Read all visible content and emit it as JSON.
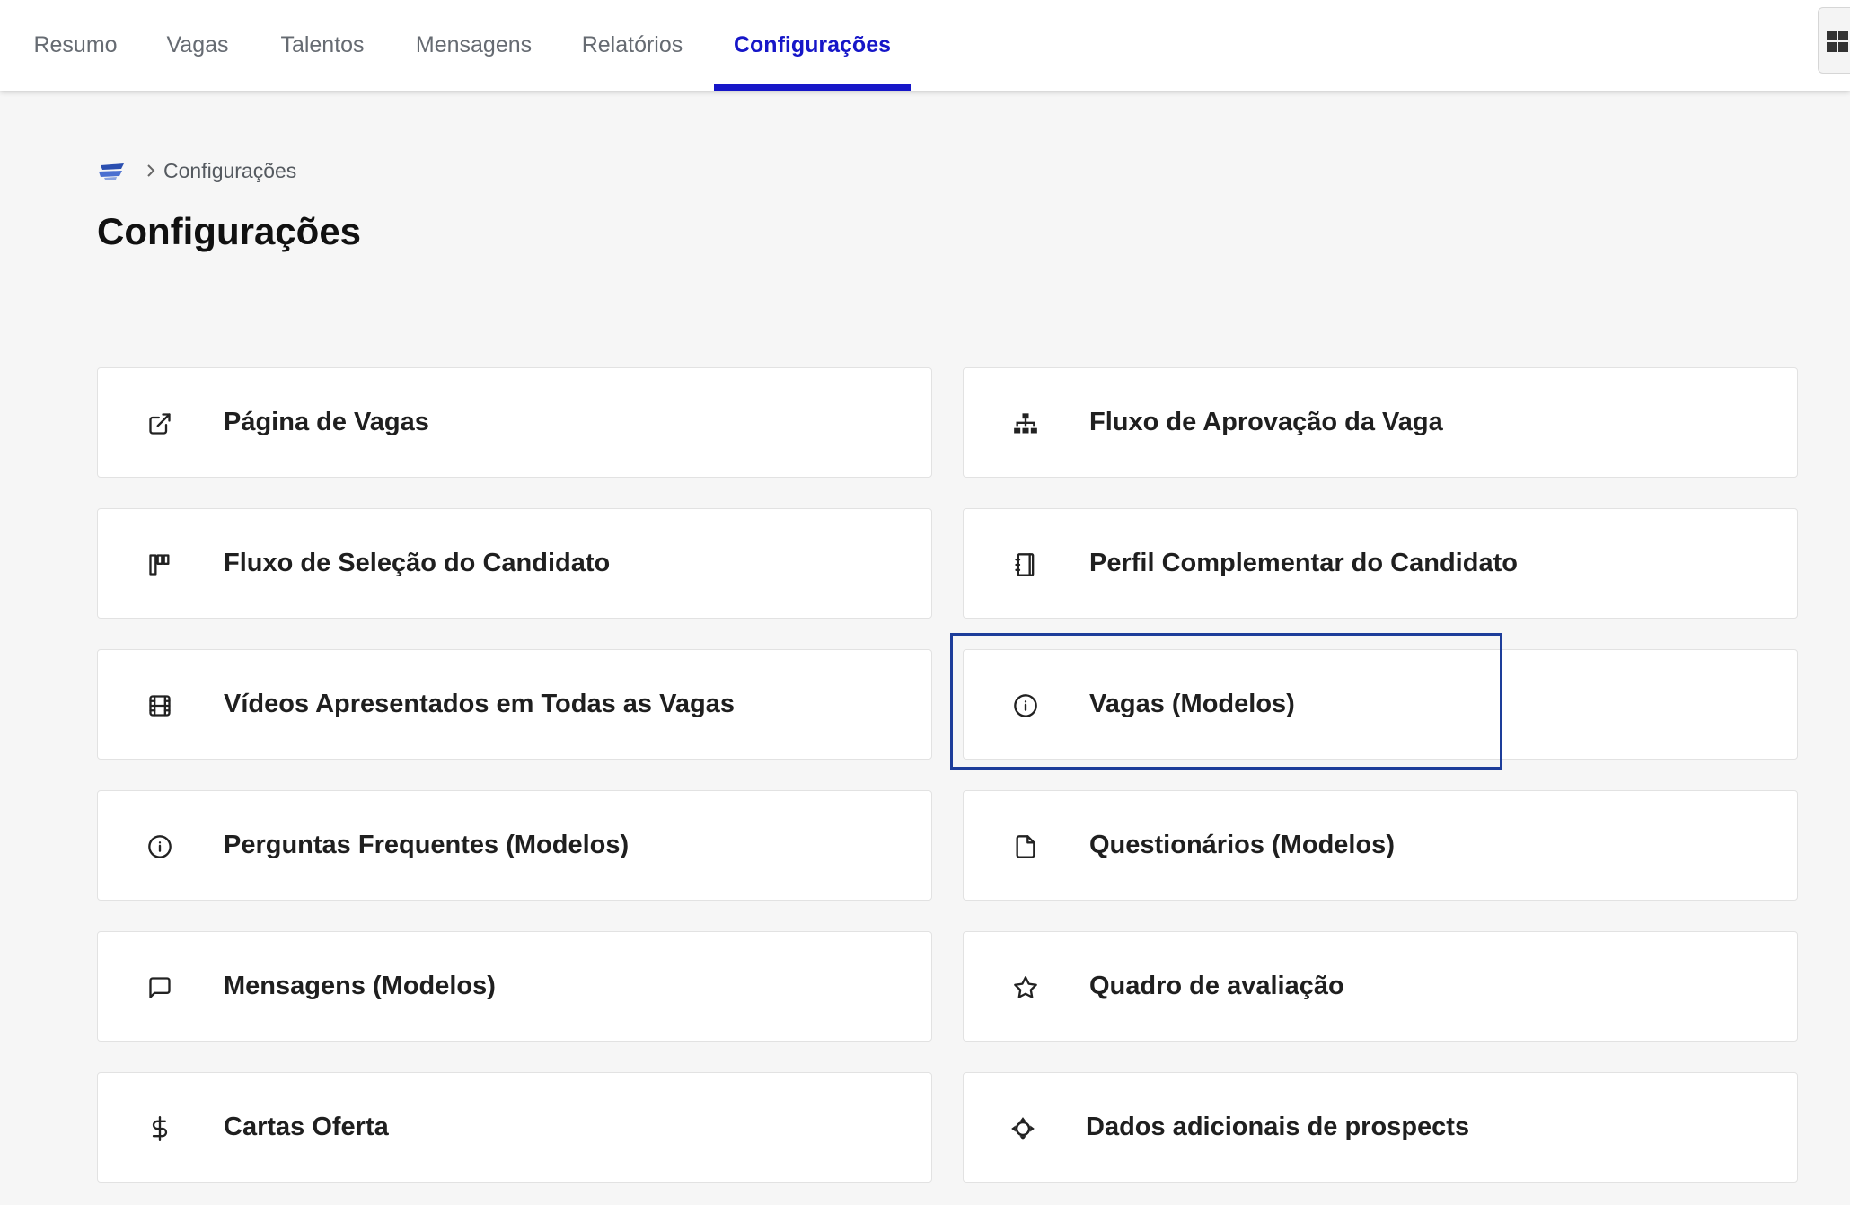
{
  "nav": {
    "tabs": [
      {
        "label": "Resumo"
      },
      {
        "label": "Vagas"
      },
      {
        "label": "Talentos"
      },
      {
        "label": "Mensagens"
      },
      {
        "label": "Relatórios"
      },
      {
        "label": "Configurações",
        "active": true
      }
    ],
    "apps_icon": "grid-apps-icon"
  },
  "breadcrumb": {
    "logo_icon": "company-logo",
    "separator_icon": "chevron-right-icon",
    "current": "Configurações"
  },
  "page": {
    "title": "Configurações"
  },
  "settings": {
    "items": [
      {
        "label": "Página de Vagas",
        "icon": "external-link-icon"
      },
      {
        "label": "Fluxo de Aprovação da Vaga",
        "icon": "hierarchy-icon"
      },
      {
        "label": "Fluxo de Seleção do Candidato",
        "icon": "kanban-columns-icon"
      },
      {
        "label": "Perfil Complementar do Candidato",
        "icon": "notebook-icon"
      },
      {
        "label": "Vídeos Apresentados em Todas as Vagas",
        "icon": "film-icon"
      },
      {
        "label": "Vagas (Modelos)",
        "icon": "info-icon",
        "highlighted": true
      },
      {
        "label": "Perguntas Frequentes (Modelos)",
        "icon": "info-icon"
      },
      {
        "label": "Questionários (Modelos)",
        "icon": "file-icon"
      },
      {
        "label": "Mensagens (Modelos)",
        "icon": "message-square-icon"
      },
      {
        "label": "Quadro de avaliação",
        "icon": "star-icon"
      },
      {
        "label": "Cartas Oferta",
        "icon": "dollar-sign-icon"
      },
      {
        "label": "Dados adicionais de prospects",
        "icon": "crosshair-move-icon"
      }
    ]
  },
  "colors": {
    "accent": "#1616c8",
    "highlight_border": "#1d3d9a",
    "background": "#f6f6f6",
    "card": "#ffffff"
  }
}
